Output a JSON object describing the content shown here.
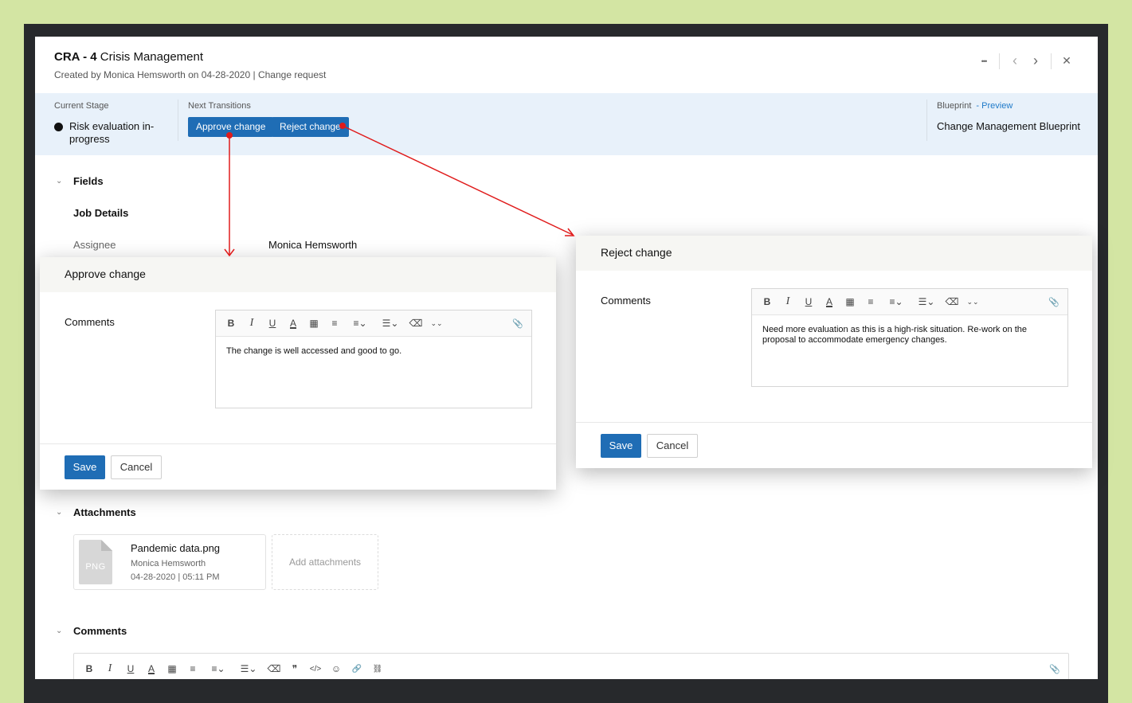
{
  "record": {
    "id": "CRA - 4",
    "name": "Crisis Management",
    "created_by_label": "Created by",
    "created_by": "Monica Hemsworth",
    "created_on": "on 04-28-2020",
    "type": "| Change request"
  },
  "header_actions": {
    "more": "•••",
    "prev": "‹",
    "next": "›",
    "close": "✕"
  },
  "stage_bar": {
    "current_stage_label": "Current Stage",
    "current_stage": "Risk evaluation in-progress",
    "next_transitions_label": "Next Transitions",
    "transitions": [
      "Approve change",
      "Reject change"
    ],
    "blueprint_label": "Blueprint",
    "preview_link": "- Preview",
    "blueprint_name": "Change Management Blueprint"
  },
  "fields_section": {
    "title": "Fields",
    "subsection": "Job Details",
    "assignee_label": "Assignee",
    "assignee_value": "Monica Hemsworth"
  },
  "attachments_section": {
    "title": "Attachments",
    "file": {
      "name": "Pandemic data.png",
      "ext": "PNG",
      "owner": "Monica Hemsworth",
      "date": "04-28-2020",
      "time": "| 05:11 PM"
    },
    "add_label": "Add attachments"
  },
  "comments_section": {
    "title": "Comments"
  },
  "approve_dialog": {
    "title": "Approve change",
    "comments_label": "Comments",
    "comment_text": "The change is well accessed and good to go.",
    "save": "Save",
    "cancel": "Cancel"
  },
  "reject_dialog": {
    "title": "Reject change",
    "comments_label": "Comments",
    "comment_text": "Need more evaluation as this is a high-risk situation. Re-work on the proposal to accommodate emergency changes.",
    "save": "Save",
    "cancel": "Cancel"
  },
  "toolbar_glyphs": {
    "bold": "B",
    "italic": "I",
    "underline": "U",
    "font_color": "A",
    "table": "▦",
    "line_height": "≡",
    "align": "≡⌄",
    "list": "☰⌄",
    "eraser": "⌫",
    "more": "⌄⌄",
    "quote": "❞",
    "code": "</>",
    "emoji": "☺",
    "link": "🔗",
    "unlink": "⛓",
    "attach": "📎"
  },
  "colors": {
    "primary": "#1f6db5",
    "stage_bg": "#e8f1fa",
    "annotation": "#e01b1b",
    "backdrop": "#d3e5a3"
  }
}
